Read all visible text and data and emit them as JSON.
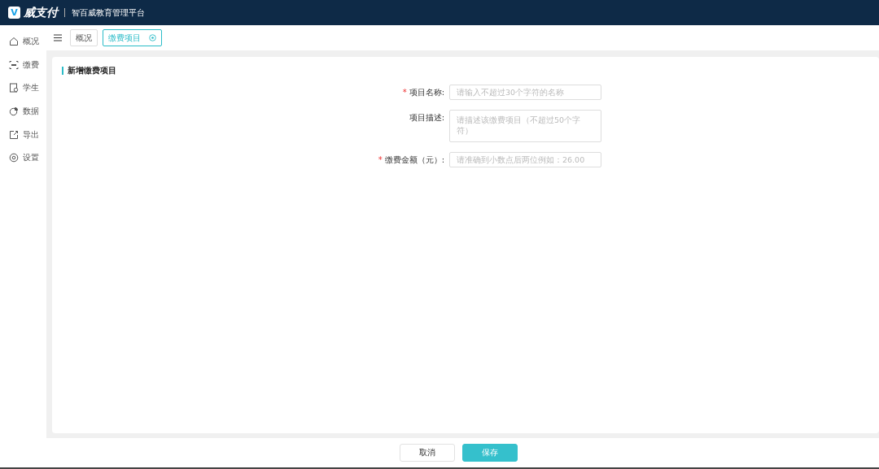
{
  "header": {
    "logo_letter": "V",
    "logo_text": "威支付",
    "platform": "智百威教育管理平台"
  },
  "sidebar": {
    "items": [
      {
        "label": "概况",
        "selected": false
      },
      {
        "label": "缴费",
        "selected": false
      },
      {
        "label": "学生",
        "selected": false
      },
      {
        "label": "数据",
        "selected": false
      },
      {
        "label": "导出",
        "selected": false
      },
      {
        "label": "设置",
        "selected": false
      }
    ]
  },
  "tabs": [
    {
      "label": "概况",
      "selected": false,
      "closable": false
    },
    {
      "label": "缴费项目",
      "selected": true,
      "closable": true
    }
  ],
  "form": {
    "title": "新增缴费项目",
    "fields": [
      {
        "label": "项目名称:",
        "required_mark": "*",
        "kind": "input",
        "placeholder": "请输入不超过30个字符的名称"
      },
      {
        "label": "项目描述:",
        "kind": "textarea",
        "placeholder": "请描述该缴费项目（不超过50个字符）"
      },
      {
        "label": "缴费金额（元）:",
        "required_mark": "*",
        "kind": "input",
        "placeholder": "请准确到小数点后两位例如：26.00"
      }
    ]
  },
  "buttons": [
    {
      "label": "取消",
      "kind": "secondary"
    },
    {
      "label": "保存",
      "kind": "primary"
    }
  ]
}
